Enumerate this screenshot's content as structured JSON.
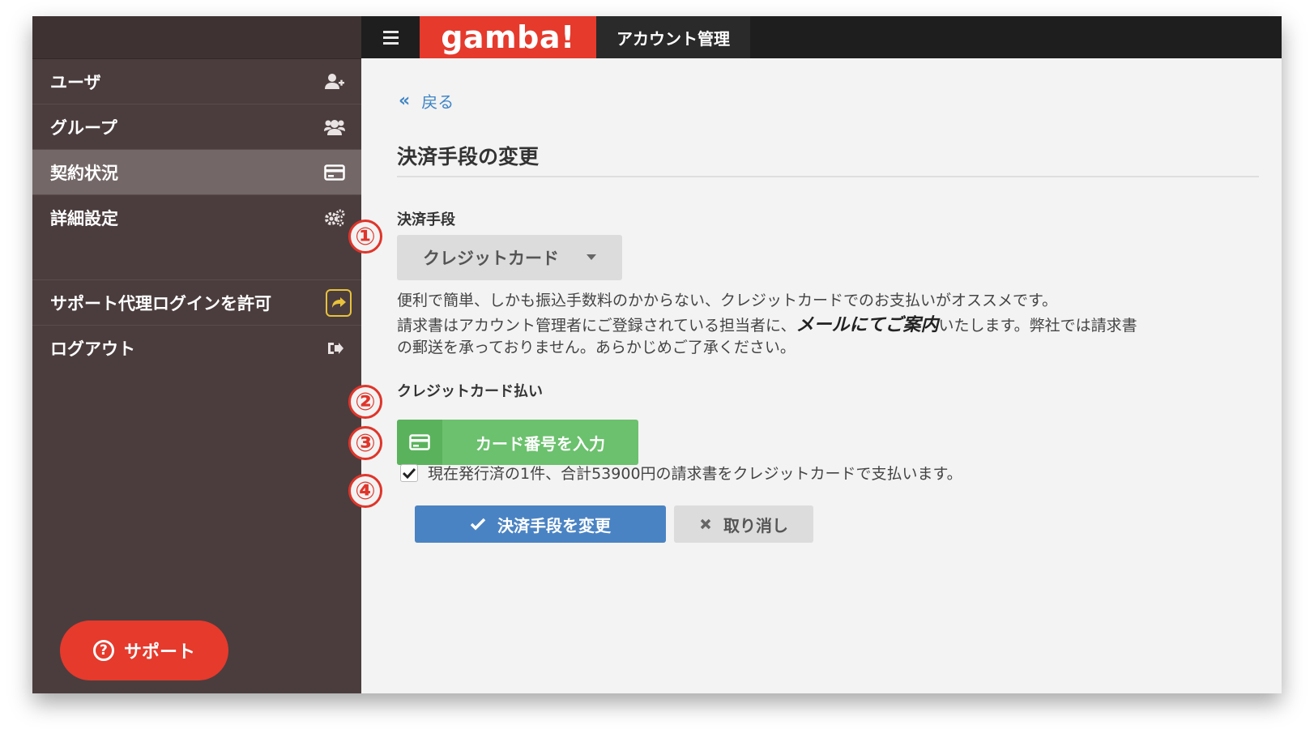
{
  "topbar": {
    "logo": "gamba!",
    "title": "アカウント管理"
  },
  "sidebar": {
    "items": [
      {
        "label": "ユーザ",
        "icon": "add-user-icon"
      },
      {
        "label": "グループ",
        "icon": "group-icon"
      },
      {
        "label": "契約状況",
        "icon": "credit-card-icon",
        "active": true
      },
      {
        "label": "詳細設定",
        "icon": "gears-icon"
      }
    ],
    "lower_items": [
      {
        "label": "サポート代理ログインを許可",
        "icon": "share-arrow-icon"
      },
      {
        "label": "ログアウト",
        "icon": "logout-icon"
      }
    ],
    "support_button": "サポート"
  },
  "main": {
    "back_link": "戻る",
    "page_title": "決済手段の変更",
    "method_label": "決済手段",
    "method_select": "クレジットカード",
    "description_line1": "便利で簡単、しかも振込手数料のかからない、クレジットカードでのお支払いがオススメです。",
    "description_line2_prefix": "請求書はアカウント管理者にご登録されている担当者に、",
    "description_line2_emphasis": "メールにてご案内",
    "description_line2_suffix": "いたします。弊社では請求書",
    "description_line3": "の郵送を承っておりません。あらかじめご了承ください。",
    "card_section_label": "クレジットカード払い",
    "card_button": "カード番号を入力",
    "checkbox_label": "現在発行済の1件、合計53900円の請求書をクレジットカードで支払います。",
    "checkbox_checked": true,
    "submit_button": "決済手段を変更",
    "cancel_button": "取り消し"
  },
  "markers": [
    "①",
    "②",
    "③",
    "④"
  ],
  "colors": {
    "sidebar": "#4b3d3e",
    "brand_red": "#e53a2c",
    "link_blue": "#3f86c6",
    "card_green": "#6bc16d",
    "submit_blue": "#4a83c3"
  }
}
